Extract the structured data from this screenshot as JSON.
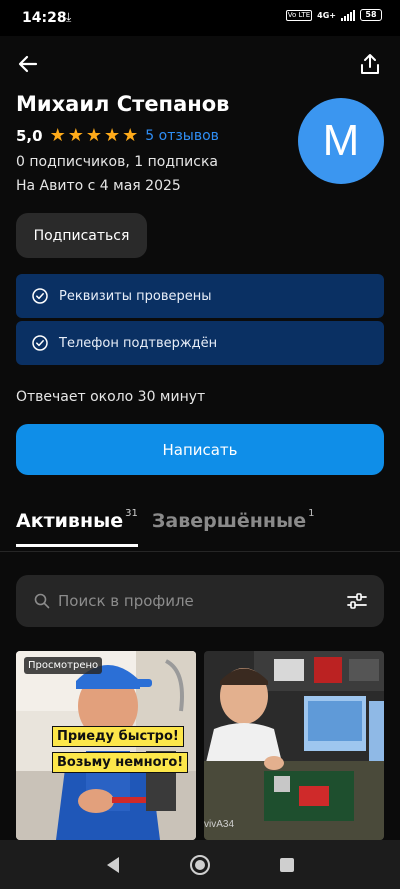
{
  "status_bar": {
    "time": "14:28",
    "network": "4G+",
    "volte": "Vo LTE",
    "battery": "58"
  },
  "header": {
    "back_icon": "arrow-left-icon",
    "share_icon": "share-icon"
  },
  "profile": {
    "name": "Михаил Степанов",
    "rating": "5,0",
    "stars": 5,
    "reviews": "5 отзывов",
    "followers": "0 подписчиков, 1 подписка",
    "since": "На Авито с 4 мая 2025",
    "avatar_letter": "M",
    "avatar_color": "#3b96f0"
  },
  "actions": {
    "subscribe": "Подписаться",
    "write": "Написать"
  },
  "verifications": [
    {
      "label": "Реквизиты проверены"
    },
    {
      "label": "Телефон подтверждён"
    }
  ],
  "response_time": "Отвечает около 30 минут",
  "tabs": [
    {
      "label": "Активные",
      "count": "31",
      "active": true
    },
    {
      "label": "Завершённые",
      "count": "1",
      "active": false
    }
  ],
  "search": {
    "placeholder": "Поиск в профиле"
  },
  "listings": [
    {
      "badge": "Просмотрено",
      "image_text": [
        "Приеду быстро!",
        "Возьму немного!"
      ]
    },
    {
      "watermark": "vivA34"
    }
  ],
  "colors": {
    "accent": "#0f8ee8",
    "link": "#2f8ef5",
    "star": "#ffab1a",
    "verify_bg": "#0a3063"
  }
}
